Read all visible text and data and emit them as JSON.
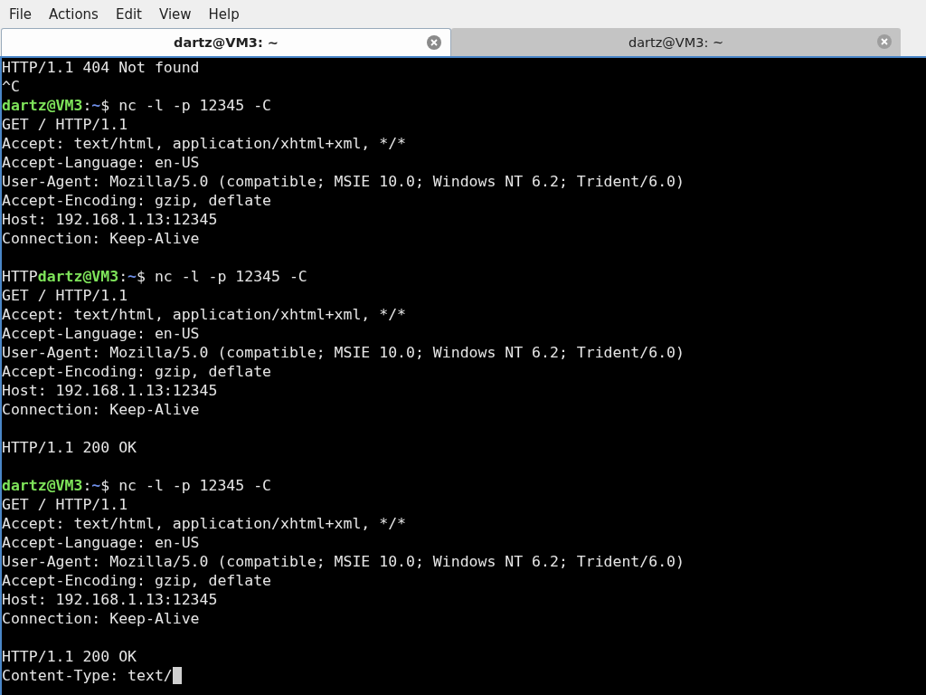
{
  "menu": [
    "File",
    "Actions",
    "Edit",
    "View",
    "Help"
  ],
  "tabs": [
    {
      "title": "dartz@VM3: ~",
      "selected": true
    },
    {
      "title": "dartz@VM3: ~",
      "selected": false
    }
  ],
  "terminal": {
    "cursor": true,
    "blocks": [
      [
        [
          {
            "kind": "plain",
            "text": "HTTP/1.1 404 Not found"
          }
        ],
        [
          {
            "kind": "plain",
            "text": "^C"
          }
        ],
        [
          {
            "kind": "user",
            "text": "dartz@VM3"
          },
          {
            "kind": "plain",
            "text": ":"
          },
          {
            "kind": "path",
            "text": "~"
          },
          {
            "kind": "plain",
            "text": "$ nc -l -p 12345 -C"
          }
        ],
        [
          {
            "kind": "plain",
            "text": "GET / HTTP/1.1"
          }
        ],
        [
          {
            "kind": "plain",
            "text": "Accept: text/html, application/xhtml+xml, */*"
          }
        ],
        [
          {
            "kind": "plain",
            "text": "Accept-Language: en-US"
          }
        ],
        [
          {
            "kind": "plain",
            "text": "User-Agent: Mozilla/5.0 (compatible; MSIE 10.0; Windows NT 6.2; Trident/6.0)"
          }
        ],
        [
          {
            "kind": "plain",
            "text": "Accept-Encoding: gzip, deflate"
          }
        ],
        [
          {
            "kind": "plain",
            "text": "Host: 192.168.1.13:12345"
          }
        ],
        [
          {
            "kind": "plain",
            "text": "Connection: Keep-Alive"
          }
        ]
      ],
      [
        [
          {
            "kind": "plain",
            "text": "HTTP"
          },
          {
            "kind": "user",
            "text": "dartz@VM3"
          },
          {
            "kind": "plain",
            "text": ":"
          },
          {
            "kind": "path",
            "text": "~"
          },
          {
            "kind": "plain",
            "text": "$ nc -l -p 12345 -C"
          }
        ],
        [
          {
            "kind": "plain",
            "text": "GET / HTTP/1.1"
          }
        ],
        [
          {
            "kind": "plain",
            "text": "Accept: text/html, application/xhtml+xml, */*"
          }
        ],
        [
          {
            "kind": "plain",
            "text": "Accept-Language: en-US"
          }
        ],
        [
          {
            "kind": "plain",
            "text": "User-Agent: Mozilla/5.0 (compatible; MSIE 10.0; Windows NT 6.2; Trident/6.0)"
          }
        ],
        [
          {
            "kind": "plain",
            "text": "Accept-Encoding: gzip, deflate"
          }
        ],
        [
          {
            "kind": "plain",
            "text": "Host: 192.168.1.13:12345"
          }
        ],
        [
          {
            "kind": "plain",
            "text": "Connection: Keep-Alive"
          }
        ]
      ],
      [
        [
          {
            "kind": "plain",
            "text": "HTTP/1.1 200 OK"
          }
        ]
      ],
      [
        [
          {
            "kind": "user",
            "text": "dartz@VM3"
          },
          {
            "kind": "plain",
            "text": ":"
          },
          {
            "kind": "path",
            "text": "~"
          },
          {
            "kind": "plain",
            "text": "$ nc -l -p 12345 -C"
          }
        ],
        [
          {
            "kind": "plain",
            "text": "GET / HTTP/1.1"
          }
        ],
        [
          {
            "kind": "plain",
            "text": "Accept: text/html, application/xhtml+xml, */*"
          }
        ],
        [
          {
            "kind": "plain",
            "text": "Accept-Language: en-US"
          }
        ],
        [
          {
            "kind": "plain",
            "text": "User-Agent: Mozilla/5.0 (compatible; MSIE 10.0; Windows NT 6.2; Trident/6.0)"
          }
        ],
        [
          {
            "kind": "plain",
            "text": "Accept-Encoding: gzip, deflate"
          }
        ],
        [
          {
            "kind": "plain",
            "text": "Host: 192.168.1.13:12345"
          }
        ],
        [
          {
            "kind": "plain",
            "text": "Connection: Keep-Alive"
          }
        ]
      ],
      [
        [
          {
            "kind": "plain",
            "text": "HTTP/1.1 200 OK"
          }
        ],
        [
          {
            "kind": "plain",
            "text": "Content-Type: text/"
          }
        ]
      ]
    ]
  }
}
